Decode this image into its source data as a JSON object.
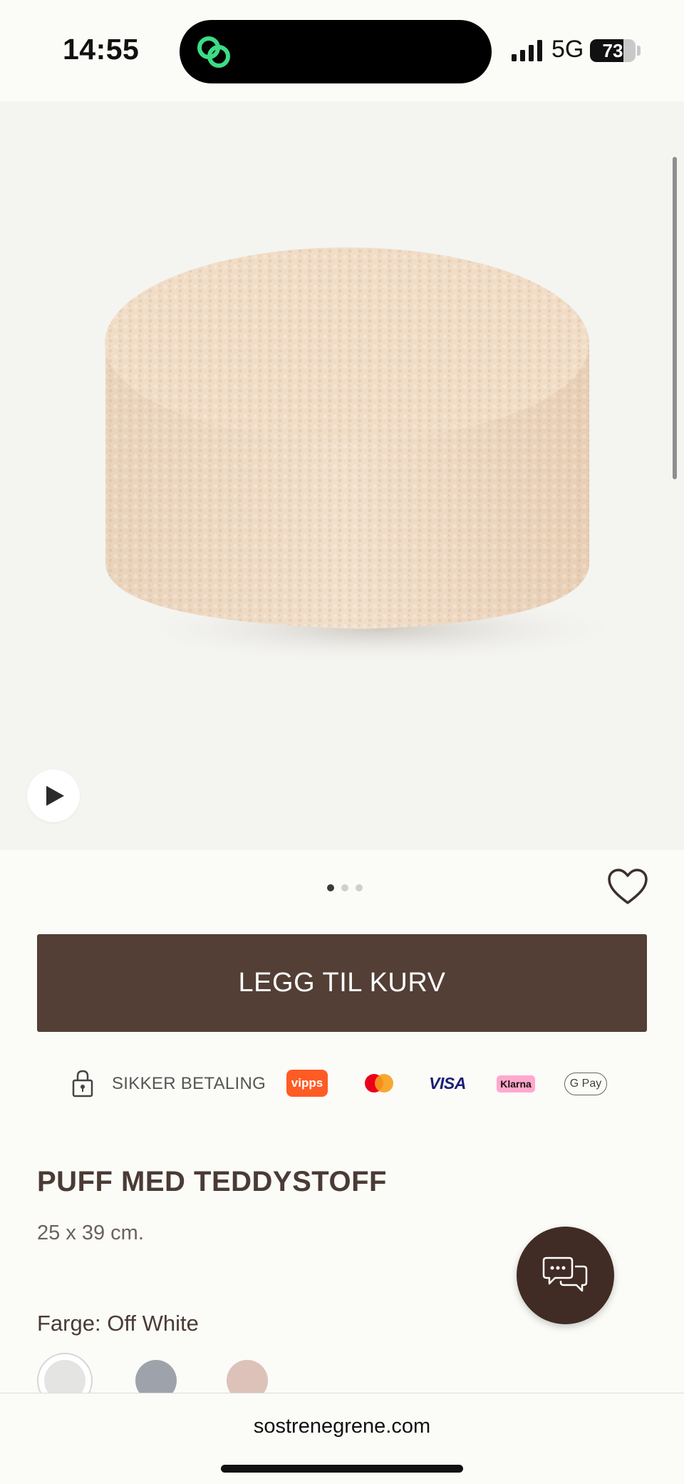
{
  "status_bar": {
    "time": "14:55",
    "network": "5G",
    "battery": "73",
    "battery_level": 0.73
  },
  "gallery": {
    "image_count": 3,
    "active_index": 0
  },
  "actions": {
    "add_to_cart": "LEGG TIL KURV"
  },
  "payment": {
    "secure_label": "SIKKER BETALING",
    "methods": [
      "vipps",
      "mastercard",
      "VISA",
      "Klarna",
      "G Pay"
    ]
  },
  "product": {
    "title": "PUFF MED TEDDYSTOFF",
    "size": "25 x 39 cm.",
    "color_label": "Farge: Off White",
    "swatches": [
      "#e4e4e2",
      "#9ea3ab",
      "#dcc2b9"
    ]
  },
  "browser": {
    "url": "sostrenegrene.com"
  },
  "colors": {
    "primary": "#533f36",
    "chat": "#402c25",
    "accent_green": "#3ddc84"
  }
}
